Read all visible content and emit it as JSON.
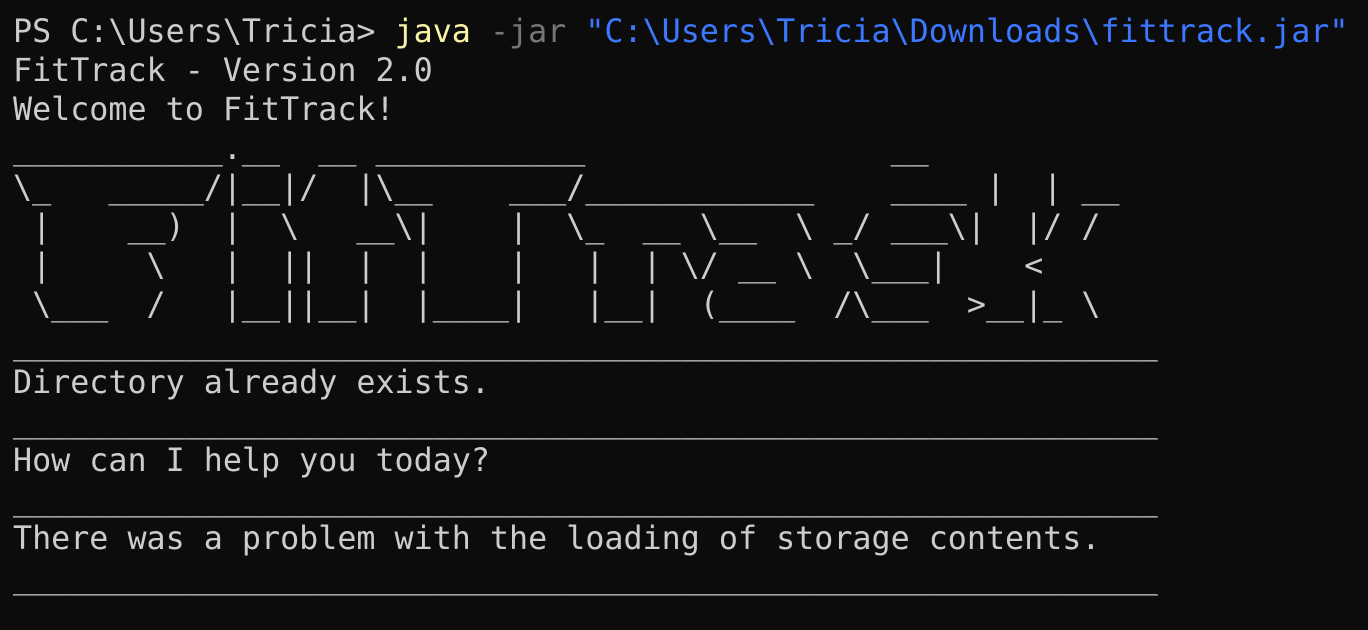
{
  "terminal": {
    "prompt": "PS C:\\Users\\Tricia> ",
    "command": {
      "program": "java",
      "flag": "-jar",
      "path": "\"C:\\Users\\Tricia\\Downloads\\fittrack.jar\""
    },
    "output": {
      "version_line": "FitTrack - Version 2.0",
      "welcome_line": "Welcome to FitTrack!",
      "ascii_art": [
        "___________.__  __ ___________                __",
        "\\_   _____/|__|/  |\\__    ___/____________    ____ |  | __",
        " |    __)  |  \\   __\\|    |  \\_  __ \\__  \\ _/ ___\\|  |/ /",
        " |     \\   |  ||  |  |    |   |  | \\/ __ \\  \\___|    <",
        " \\___  /   |__||__|  |____|   |__|  (____  /\\___  >__|_ \\"
      ],
      "separator": "____________________________________________________________",
      "messages": [
        "Directory already exists.",
        "How can I help you today?",
        "There was a problem with the loading of storage contents."
      ]
    },
    "colors": {
      "background": "#0c0c0c",
      "foreground": "#cccccc",
      "command_program": "#f9f1a5",
      "command_flag": "#767676",
      "command_path": "#3b78ff"
    }
  }
}
